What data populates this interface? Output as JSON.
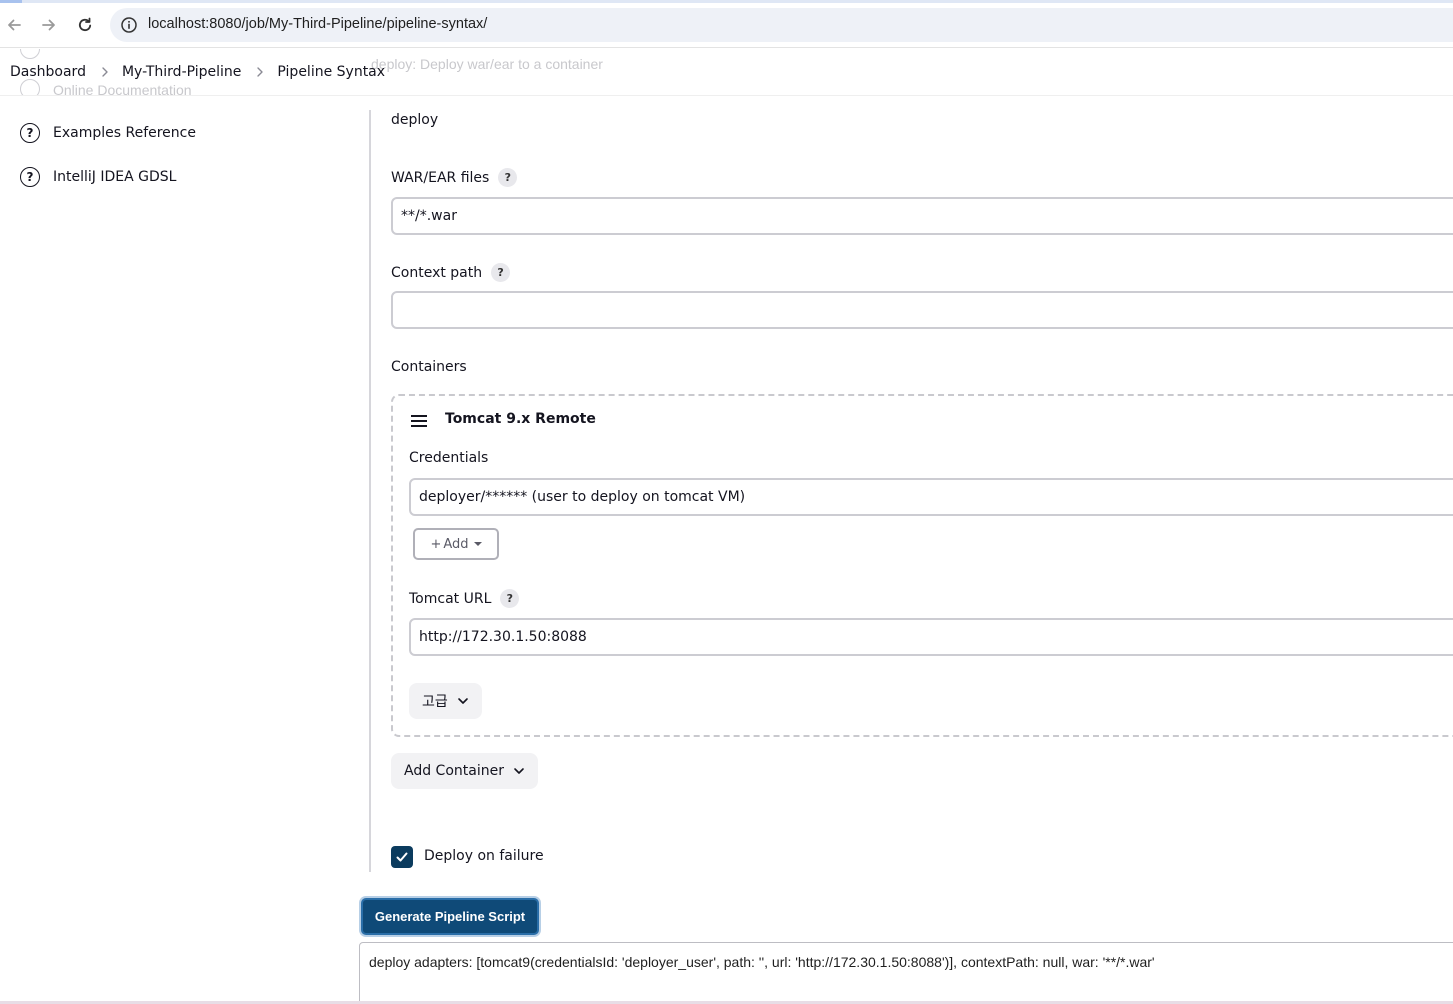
{
  "browser": {
    "url": "localhost:8080/job/My-Third-Pipeline/pipeline-syntax/"
  },
  "breadcrumbs": [
    "Dashboard",
    "My-Third-Pipeline",
    "Pipeline Syntax"
  ],
  "ghost": {
    "step_header": "deploy: Deploy war/ear to a container",
    "online_docs": "Online Documentation"
  },
  "sidebar": {
    "items": [
      {
        "label": "Examples Reference",
        "icon": "help-circle-icon"
      },
      {
        "label": "IntelliJ IDEA GDSL",
        "icon": "help-circle-icon"
      }
    ]
  },
  "form": {
    "step_name": "deploy",
    "war_label": "WAR/EAR files",
    "war_value": "**/*.war",
    "context_label": "Context path",
    "context_value": "",
    "containers_label": "Containers",
    "container": {
      "title": "Tomcat 9.x Remote",
      "credentials_label": "Credentials",
      "credentials_value": "deployer/****** (user to deploy on tomcat VM)",
      "add_label": "Add",
      "url_label": "Tomcat URL",
      "url_value": "http://172.30.1.50:8088",
      "advanced_label": "고급"
    },
    "add_container_label": "Add Container",
    "deploy_on_failure_label": "Deploy on failure",
    "deploy_on_failure_checked": true
  },
  "generate_button": "Generate Pipeline Script",
  "output_script": "deploy adapters: [tomcat9(credentialsId: 'deployer_user', path: '', url: 'http://172.30.1.50:8088')], contextPath: null, war: '**/*.war'",
  "colors": {
    "primary_button": "#0f4a78",
    "checkbox": "#0b3b5e"
  }
}
